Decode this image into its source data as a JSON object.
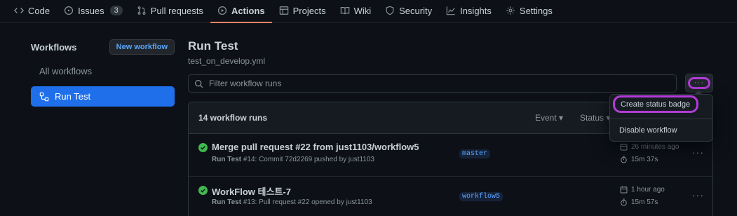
{
  "nav": {
    "items": [
      {
        "label": "Code",
        "icon": "code-icon"
      },
      {
        "label": "Issues",
        "icon": "issue-opened-icon",
        "count": "3"
      },
      {
        "label": "Pull requests",
        "icon": "git-pull-request-icon"
      },
      {
        "label": "Actions",
        "icon": "play-icon",
        "active": true
      },
      {
        "label": "Projects",
        "icon": "table-icon"
      },
      {
        "label": "Wiki",
        "icon": "book-icon"
      },
      {
        "label": "Security",
        "icon": "shield-icon"
      },
      {
        "label": "Insights",
        "icon": "graph-icon"
      },
      {
        "label": "Settings",
        "icon": "gear-icon"
      }
    ]
  },
  "sidebar": {
    "title": "Workflows",
    "new_button": "New workflow",
    "all_label": "All workflows",
    "selected_label": "Run Test"
  },
  "main": {
    "title": "Run Test",
    "subtitle": "test_on_develop.yml",
    "filter_placeholder": "Filter workflow runs",
    "more_label": "···",
    "runs_count": "14 workflow runs",
    "filters": {
      "event": "Event ▾",
      "status": "Status ▾"
    }
  },
  "runs": [
    {
      "title": "Merge pull request #22 from just1103/workflow5",
      "meta_bold": "Run Test",
      "meta": " #14: Commit 72d2269 pushed by just1103",
      "branch": "master",
      "when": "26 minutes ago",
      "duration": "15m 37s",
      "status": "success"
    },
    {
      "title": "WorkFlow 테스트-7",
      "meta_bold": "Run Test",
      "meta": " #13: Pull request #22 opened by just1103",
      "branch": "workflow5",
      "when": "1 hour ago",
      "duration": "15m 57s",
      "status": "success"
    }
  ],
  "dropdown": {
    "create_badge": "Create status badge",
    "disable": "Disable workflow"
  },
  "colors": {
    "accent": "#1f6feb",
    "highlight_ring": "#b23bd6",
    "success": "#3fb950",
    "active_underline": "#f78166"
  }
}
